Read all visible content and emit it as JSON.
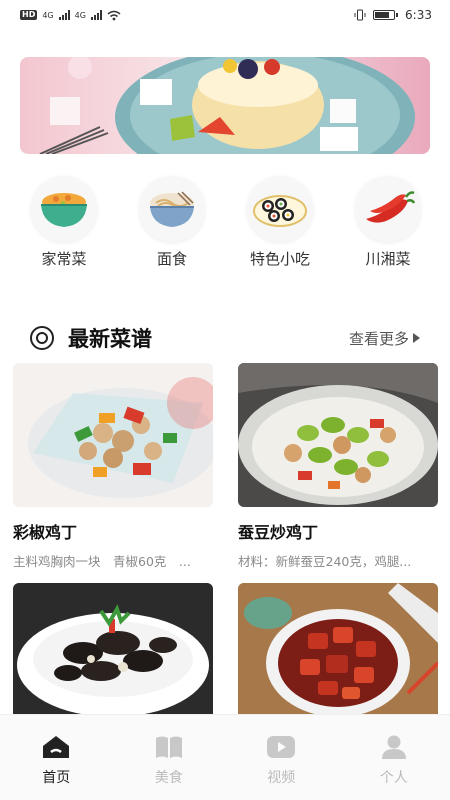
{
  "status_bar": {
    "hd": "HD",
    "net1": "4G",
    "net2": "4G",
    "time": "6:33"
  },
  "banner": {
    "icon": "pancake-dessert-photo"
  },
  "categories": [
    {
      "label": "家常菜",
      "icon": "bowl-of-rice-icon"
    },
    {
      "label": "面食",
      "icon": "noodle-bowl-icon"
    },
    {
      "label": "特色小吃",
      "icon": "sushi-plate-icon"
    },
    {
      "label": "川湘菜",
      "icon": "red-chili-icon"
    }
  ],
  "section": {
    "title": "最新菜谱",
    "more": "查看更多"
  },
  "recipes": [
    {
      "title": "彩椒鸡丁",
      "desc": "主料鸡胸肉一块　青椒60克　...",
      "icon": "pepper-chicken-photo"
    },
    {
      "title": "蚕豆炒鸡丁",
      "desc": "材料：新鲜蚕豆240克，鸡腿...",
      "icon": "broad-bean-chicken-photo"
    },
    {
      "title": "",
      "desc": "",
      "icon": "wood-ear-mushroom-photo"
    },
    {
      "title": "",
      "desc": "",
      "icon": "braised-pork-photo"
    }
  ],
  "bottom_nav": [
    {
      "label": "首页",
      "icon": "home-icon",
      "active": true
    },
    {
      "label": "美食",
      "icon": "book-icon",
      "active": false
    },
    {
      "label": "视频",
      "icon": "play-icon",
      "active": false
    },
    {
      "label": "个人",
      "icon": "person-icon",
      "active": false
    }
  ],
  "colors": {
    "active_nav": "#222222",
    "inactive_nav": "#bbbbbb",
    "accent_red": "#d63a2b"
  }
}
